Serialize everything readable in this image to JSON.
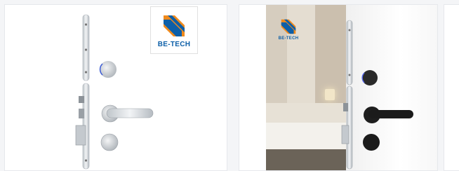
{
  "cards": [
    {
      "logo_text": "BE-TECH"
    },
    {
      "logo_text": "BE-TECH"
    }
  ],
  "colors": {
    "brand_blue": "#0d5fa8",
    "brand_orange": "#f08a1c",
    "plate_silver": "#d9dde1",
    "reader_black": "#1b1b1b"
  },
  "icons": [
    "be-tech-logo",
    "door-lock-faceplate",
    "card-reader-icon",
    "lever-handle",
    "thumb-turn"
  ]
}
